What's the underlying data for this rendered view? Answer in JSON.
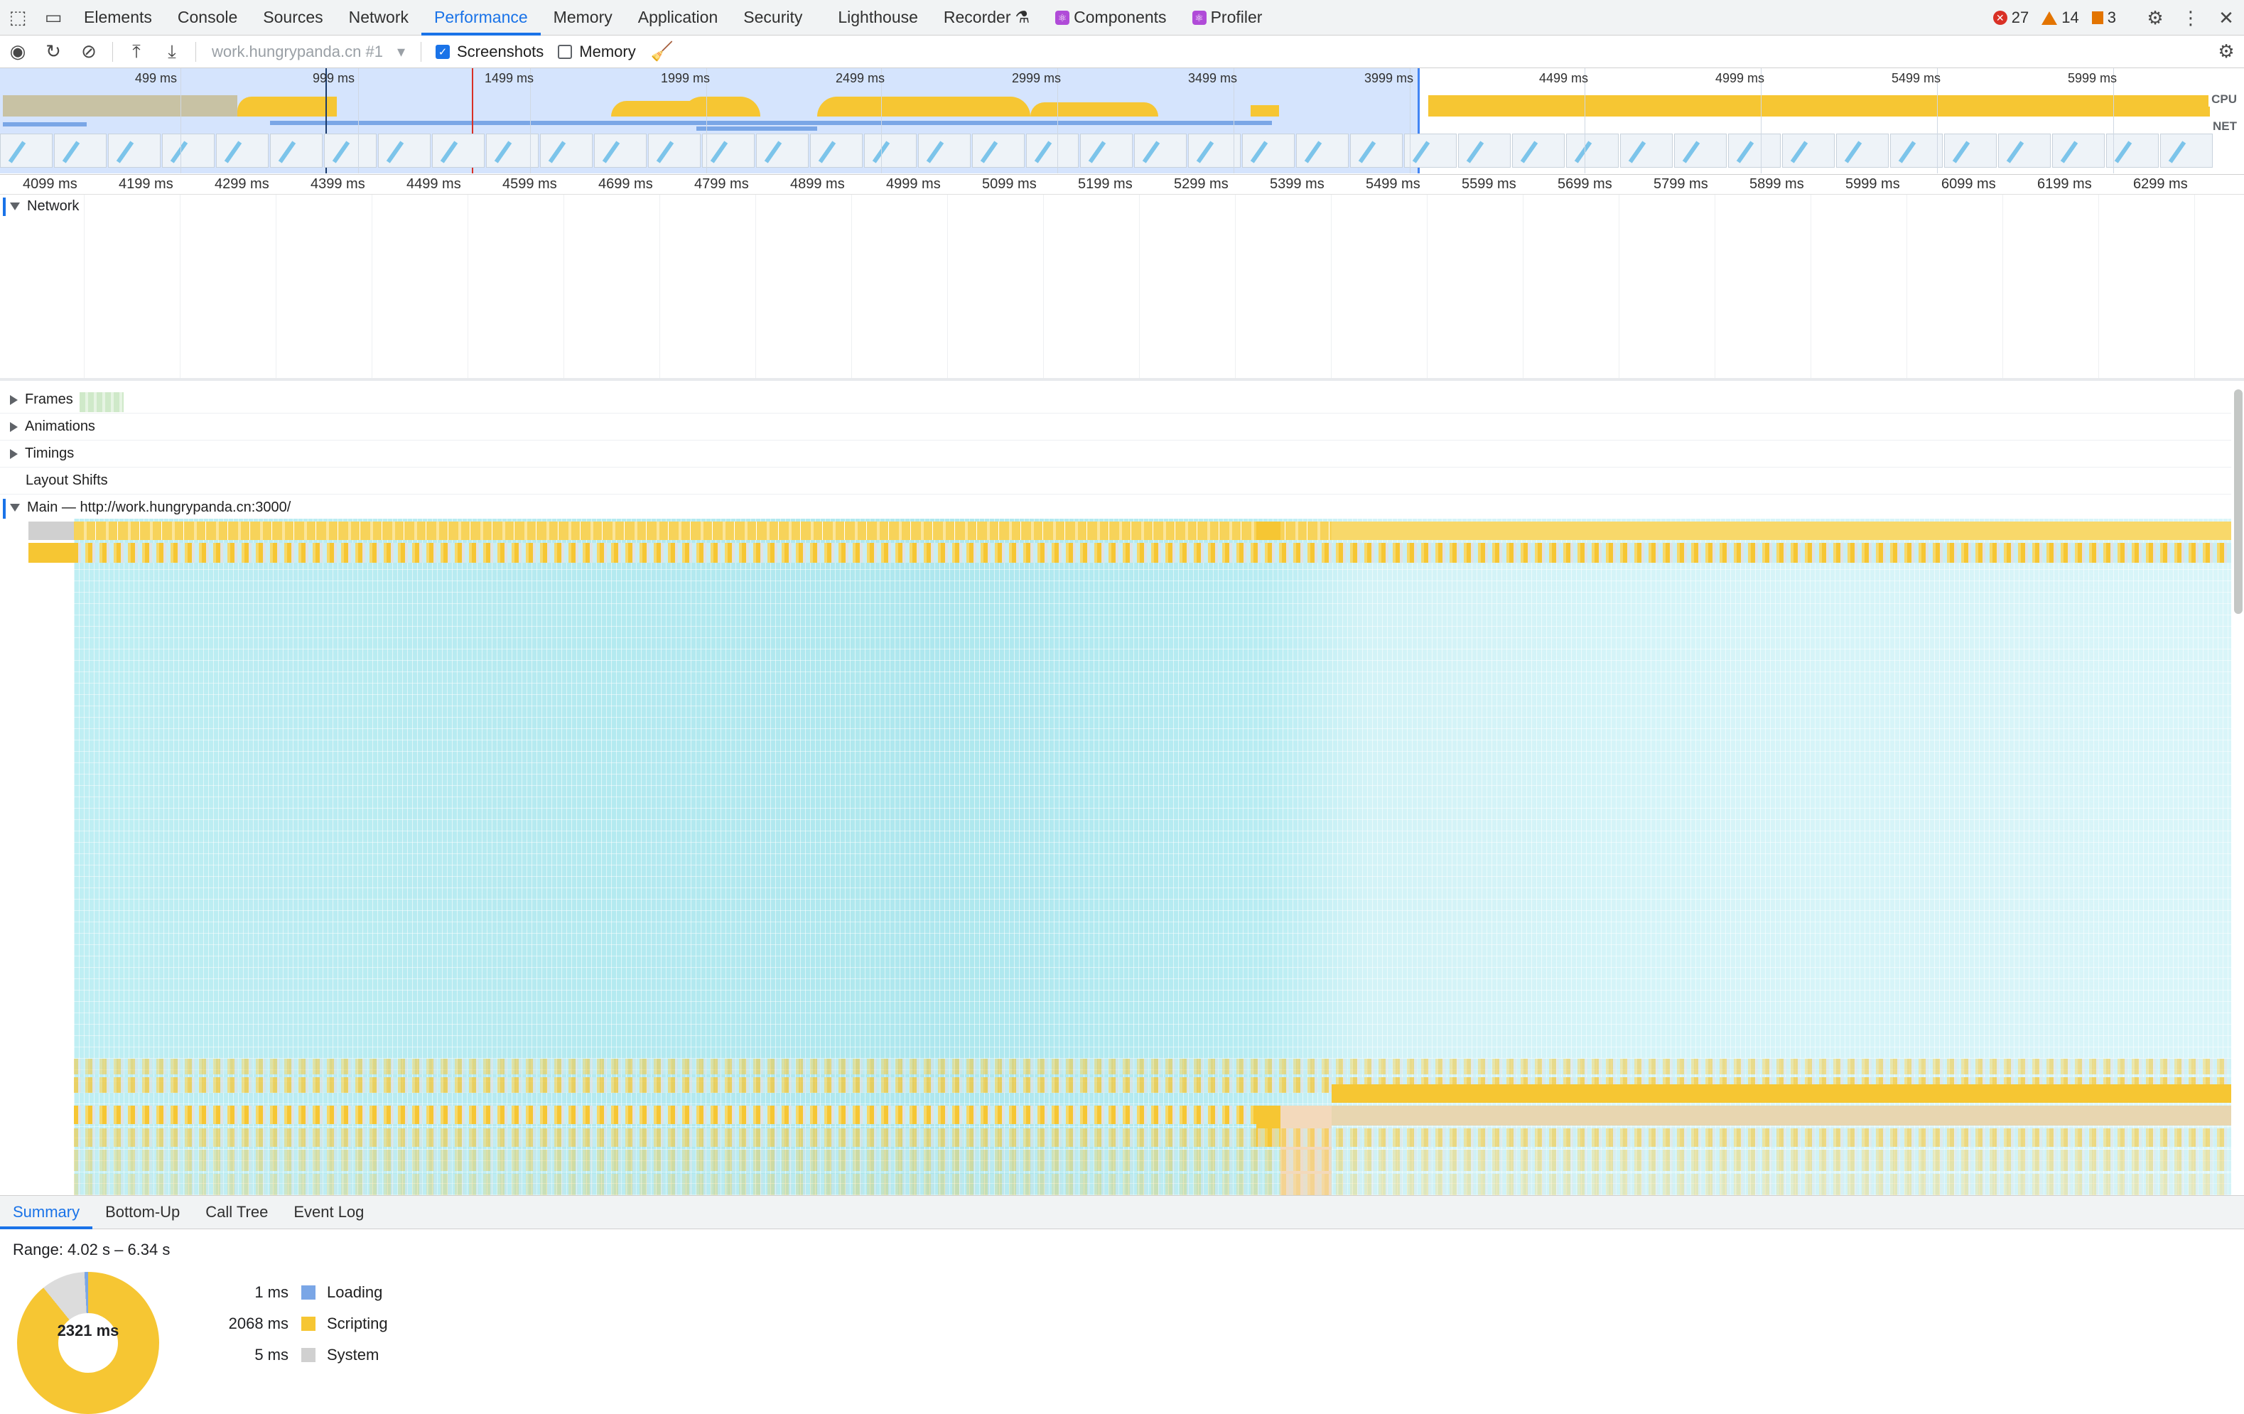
{
  "tabs": [
    "Elements",
    "Console",
    "Sources",
    "Network",
    "Performance",
    "Memory",
    "Application",
    "Security",
    "Lighthouse",
    "Recorder",
    "Components",
    "Profiler"
  ],
  "active_tab": "Performance",
  "status": {
    "errors": "27",
    "warnings": "14",
    "issues": "3"
  },
  "toolbar": {
    "profile_select": "work.hungrypanda.cn #1",
    "screenshots_label": "Screenshots",
    "screenshots_checked": true,
    "memory_label": "Memory",
    "memory_checked": false
  },
  "overview": {
    "ticks": [
      "499 ms",
      "999 ms",
      "1499 ms",
      "1999 ms",
      "2499 ms",
      "2999 ms",
      "3499 ms",
      "3999 ms",
      "4499 ms",
      "4999 ms",
      "5499 ms",
      "5999 ms"
    ],
    "cpu_label": "CPU",
    "net_label": "NET"
  },
  "ruler": [
    "4099 ms",
    "4199 ms",
    "4299 ms",
    "4399 ms",
    "4499 ms",
    "4599 ms",
    "4699 ms",
    "4799 ms",
    "4899 ms",
    "4999 ms",
    "5099 ms",
    "5199 ms",
    "5299 ms",
    "5399 ms",
    "5499 ms",
    "5599 ms",
    "5699 ms",
    "5799 ms",
    "5899 ms",
    "5999 ms",
    "6099 ms",
    "6199 ms",
    "6299 ms"
  ],
  "tracks": {
    "network": "Network",
    "frames": "Frames",
    "animations": "Animations",
    "timings": "Timings",
    "layout_shifts": "Layout Shifts",
    "main": "Main — http://work.hungrypanda.cn:3000/"
  },
  "bottom_tabs": [
    "Summary",
    "Bottom-Up",
    "Call Tree",
    "Event Log"
  ],
  "active_bottom_tab": "Summary",
  "summary": {
    "range": "Range: 4.02 s – 6.34 s",
    "total": "2321 ms",
    "rows": [
      {
        "ms": "1 ms",
        "label": "Loading",
        "color": "#7aa6e6"
      },
      {
        "ms": "2068 ms",
        "label": "Scripting",
        "color": "#f6c633"
      },
      {
        "ms": "5 ms",
        "label": "System",
        "color": "#d0d0d0"
      }
    ]
  }
}
